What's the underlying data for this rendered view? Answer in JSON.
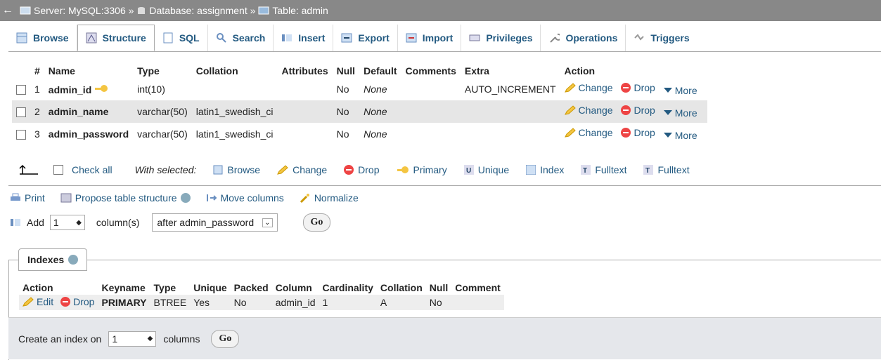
{
  "breadcrumb": {
    "back": "←",
    "server": "Server: MySQL:3306 »",
    "database": "Database: assignment »",
    "table": "Table: admin"
  },
  "tabs": [
    {
      "label": "Browse",
      "icon": "table-icon"
    },
    {
      "label": "Structure",
      "icon": "structure-icon"
    },
    {
      "label": "SQL",
      "icon": "sql-icon"
    },
    {
      "label": "Search",
      "icon": "search-icon"
    },
    {
      "label": "Insert",
      "icon": "insert-icon"
    },
    {
      "label": "Export",
      "icon": "export-icon"
    },
    {
      "label": "Import",
      "icon": "import-icon"
    },
    {
      "label": "Privileges",
      "icon": "privileges-icon"
    },
    {
      "label": "Operations",
      "icon": "wrench-icon"
    },
    {
      "label": "Triggers",
      "icon": "triggers-icon"
    }
  ],
  "structure": {
    "headers": [
      "#",
      "Name",
      "Type",
      "Collation",
      "Attributes",
      "Null",
      "Default",
      "Comments",
      "Extra",
      "Action"
    ],
    "rows": [
      {
        "num": "1",
        "name": "admin_id",
        "type": "int(10)",
        "collation": "",
        "attributes": "",
        "null": "No",
        "default": "None",
        "comments": "",
        "extra": "AUTO_INCREMENT"
      },
      {
        "num": "2",
        "name": "admin_name",
        "type": "varchar(50)",
        "collation": "latin1_swedish_ci",
        "attributes": "",
        "null": "No",
        "default": "None",
        "comments": "",
        "extra": ""
      },
      {
        "num": "3",
        "name": "admin_password",
        "type": "varchar(50)",
        "collation": "latin1_swedish_ci",
        "attributes": "",
        "null": "No",
        "default": "None",
        "comments": "",
        "extra": ""
      }
    ],
    "row_actions": {
      "change": "Change",
      "drop": "Drop",
      "more": "More"
    }
  },
  "with_selected": {
    "check_all": "Check all",
    "label": "With selected:",
    "browse": "Browse",
    "change": "Change",
    "drop": "Drop",
    "primary": "Primary",
    "unique": "Unique",
    "index": "Index",
    "fulltext1": "Fulltext",
    "fulltext2": "Fulltext"
  },
  "tools": {
    "print": "Print",
    "propose": "Propose table structure",
    "move": "Move columns",
    "normalize": "Normalize"
  },
  "add_columns": {
    "add": "Add",
    "count": "1",
    "columns": "column(s)",
    "position": "after admin_password",
    "go": "Go"
  },
  "indexes": {
    "legend": "Indexes",
    "headers": [
      "Action",
      "Keyname",
      "Type",
      "Unique",
      "Packed",
      "Column",
      "Cardinality",
      "Collation",
      "Null",
      "Comment"
    ],
    "row": {
      "edit": "Edit",
      "drop": "Drop",
      "keyname": "PRIMARY",
      "type": "BTREE",
      "unique": "Yes",
      "packed": "No",
      "column": "admin_id",
      "cardinality": "1",
      "collation": "A",
      "null": "No",
      "comment": ""
    }
  },
  "create_index": {
    "label": "Create an index on",
    "count": "1",
    "columns": "columns",
    "go": "Go"
  }
}
